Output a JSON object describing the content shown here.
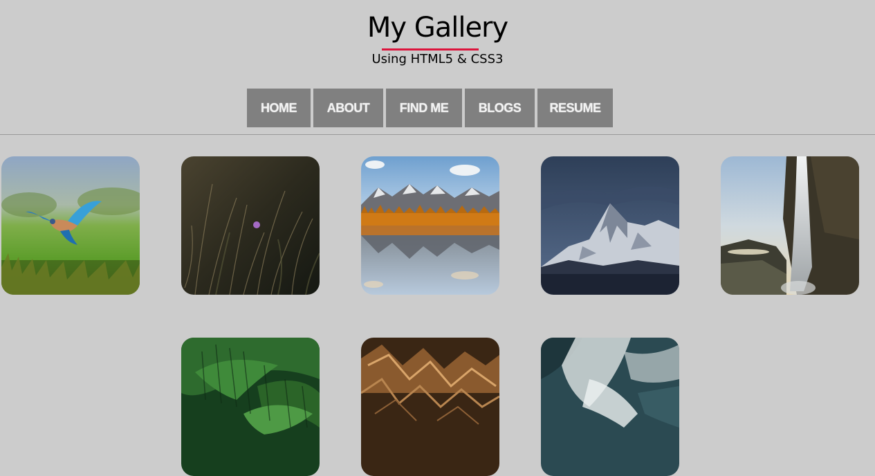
{
  "header": {
    "title": "My Gallery",
    "subtitle": "Using HTML5 & CSS3",
    "accent_color": "#dc143c"
  },
  "nav": {
    "items": [
      {
        "label": "HOME"
      },
      {
        "label": "ABOUT"
      },
      {
        "label": "FIND ME"
      },
      {
        "label": "BLOGS"
      },
      {
        "label": "RESUME"
      }
    ]
  },
  "gallery": {
    "images": [
      {
        "subject": "kingfisher bird in flight over grass"
      },
      {
        "subject": "dark wild grass with small purple flower"
      },
      {
        "subject": "snowy mountains with autumn trees reflected in lake"
      },
      {
        "subject": "snow-capped mountain peak under dark clouds"
      },
      {
        "subject": "waterfall over dark cliff"
      },
      {
        "subject": "green palm fronds"
      },
      {
        "subject": "eroded desert ridges"
      },
      {
        "subject": "aerial ocean waves"
      }
    ]
  }
}
